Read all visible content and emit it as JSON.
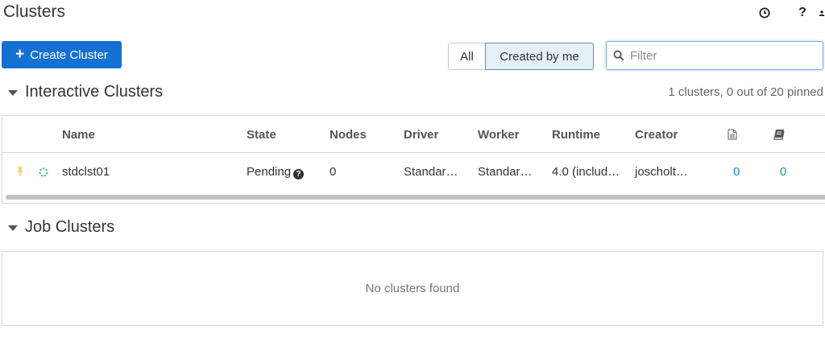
{
  "page": {
    "title": "Clusters"
  },
  "top_icons": [
    "clock-icon",
    "help-icon",
    "user-icon"
  ],
  "help_symbol": "?",
  "toolbar": {
    "create_label": "Create Cluster",
    "create_icon": "plus-icon",
    "filter_all": "All",
    "filter_mine": "Created by me",
    "filter_selected": "Created by me",
    "search_placeholder": "Filter",
    "accent_color": "#1570d4"
  },
  "interactive": {
    "title": "Interactive Clusters",
    "summary": "1 clusters, 0 out of 20 pinned",
    "columns": {
      "name": "Name",
      "state": "State",
      "nodes": "Nodes",
      "driver": "Driver",
      "worker": "Worker",
      "runtime": "Runtime",
      "creator": "Creator",
      "notebooks_icon": "document-icon",
      "libraries_icon": "book-icon"
    },
    "rows": [
      {
        "pinned_icon": "pin-icon",
        "status_icon": "spinner-icon",
        "name": "stdclst01",
        "state": "Pending",
        "state_icon": "question-circle-icon",
        "nodes": "0",
        "driver": "Standar…",
        "worker": "Standar…",
        "runtime": "4.0 (includ…",
        "creator": "joscholt…",
        "notebooks": "0",
        "libraries": "0"
      }
    ]
  },
  "job": {
    "title": "Job Clusters",
    "empty_message": "No clusters found"
  }
}
